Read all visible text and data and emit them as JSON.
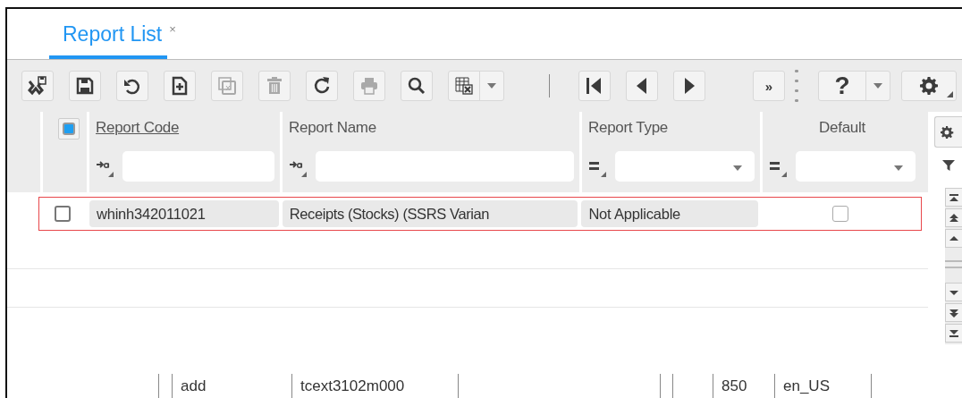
{
  "tabs": [
    {
      "label": "Report List",
      "selected": true,
      "close": "×"
    }
  ],
  "toolbar": {
    "groups": [
      [
        {
          "disabled": false
        },
        {
          "disabled": false
        },
        {
          "disabled": false
        },
        {
          "disabled": false
        },
        {
          "disabled": true
        },
        {
          "disabled": true
        },
        {
          "disabled": false
        },
        {
          "disabled": true
        },
        {
          "disabled": false
        },
        {
          "disabled": false
        }
      ],
      [
        {
          "disabled": false
        },
        {
          "disabled": false
        },
        {
          "disabled": false
        }
      ],
      [
        {
          "label": "»",
          "disabled": false
        }
      ],
      [
        {
          "label": "?",
          "disabled": false
        },
        {
          "disabled": false
        }
      ]
    ]
  },
  "table": {
    "select_all": {
      "checked": true
    },
    "columns": [
      {
        "label": "Report Code",
        "sorted": true
      },
      {
        "label": "Report Name",
        "sorted": false
      },
      {
        "label": "Report Type",
        "sorted": false
      },
      {
        "label": "Default",
        "sorted": false
      }
    ],
    "rows": [
      {
        "selected": false,
        "focused": true,
        "cells": [
          {
            "kind": "text",
            "value": "whinh342011021"
          },
          {
            "kind": "text",
            "value": "Receipts (Stocks) (SSRS Varian"
          },
          {
            "kind": "text",
            "value": "Not Applicable"
          },
          {
            "kind": "checkbox",
            "checked": false
          }
        ]
      }
    ]
  },
  "status_bar": [
    "add",
    "tcext3102m000",
    "850",
    "en_US"
  ]
}
